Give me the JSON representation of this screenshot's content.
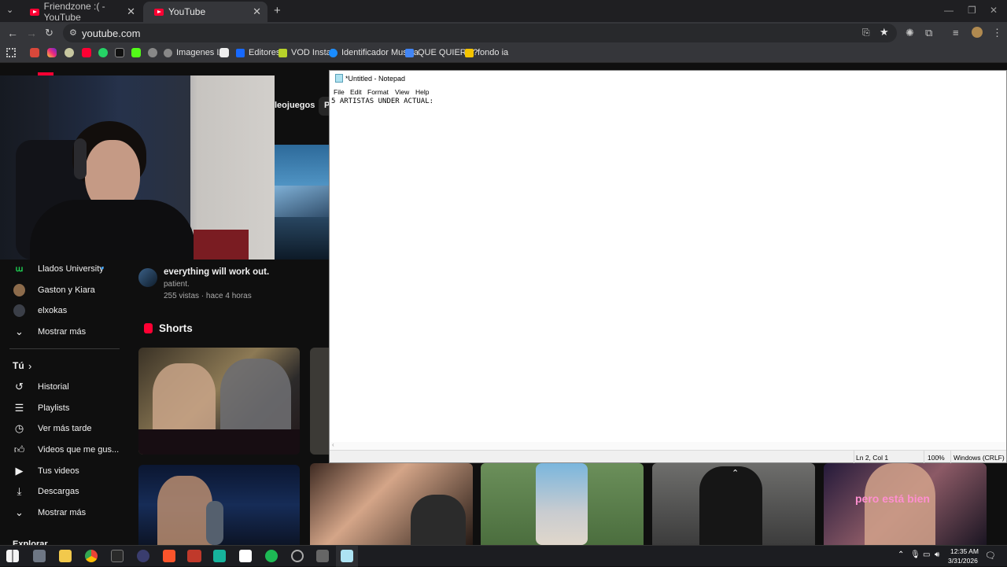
{
  "browser": {
    "tabs": [
      {
        "label": "Friendzone :( - YouTube",
        "close": "✕"
      },
      {
        "label": "YouTube",
        "close": "✕"
      }
    ],
    "new_tab": "+",
    "url": "youtube.com",
    "bookmarks": [
      "Imagenes IA",
      "Editores",
      "VOD Install",
      "Identificador Musica",
      "QUE QUIERO?",
      "fondo ia"
    ]
  },
  "youtube": {
    "subscriptions": [
      {
        "label": "Llados University",
        "dot": "•"
      },
      {
        "label": "Gaston y Kiara"
      },
      {
        "label": "elxokas"
      },
      {
        "label": "Mostrar más"
      }
    ],
    "you_section": {
      "title": "Tú",
      "chevron": "›",
      "items": [
        "Historial",
        "Playlists",
        "Ver más tarde",
        "Videos que me gus...",
        "Tus videos",
        "Descargas",
        "Mostrar más"
      ]
    },
    "explore_title": "Explorar",
    "chip_label": "leojuegos",
    "chip_partial": "P",
    "video": {
      "title": "everything will work out.",
      "channel": "patient.",
      "meta": "255 vistas · hace 4 horas"
    },
    "shorts_title": "Shorts",
    "short_caption": "pero está bien"
  },
  "notepad": {
    "title": "*Untitled - Notepad",
    "menu": [
      "File",
      "Edit",
      "Format",
      "View",
      "Help"
    ],
    "content": "5 ARTISTAS UNDER ACTUAL:",
    "status": {
      "position": "Ln 2, Col 1",
      "zoom": "100%",
      "eol": "Windows (CRLF)"
    }
  },
  "taskbar": {
    "time": "12:35 AM",
    "date": "3/31/2026"
  },
  "colors": {
    "youtube_red": "#ff0033",
    "chrome_dark": "#35363a",
    "yt_bg": "#0f0f0f"
  }
}
